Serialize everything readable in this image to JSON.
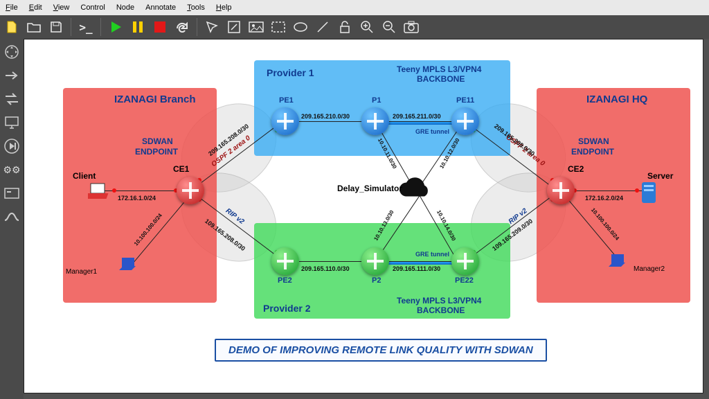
{
  "menu": {
    "file": "File",
    "edit": "Edit",
    "view": "View",
    "control": "Control",
    "node": "Node",
    "annotate": "Annotate",
    "tools": "Tools",
    "help": "Help"
  },
  "toolbar_icons": [
    "new-file-icon",
    "open-icon",
    "save-icon",
    "terminal-icon",
    "play-icon",
    "pause-icon",
    "stop-icon",
    "redo-icon",
    "select-icon",
    "edit-box-icon",
    "image-icon",
    "marquee-icon",
    "ellipse-icon",
    "line-icon",
    "lock-icon",
    "zoom-in-icon",
    "zoom-out-icon",
    "camera-icon"
  ],
  "sidebar_icons": [
    "move-icon",
    "arrow-right-icon",
    "arrow-bidir-icon",
    "monitor-icon",
    "step-icon",
    "gears-icon",
    "host-icon",
    "route-icon"
  ],
  "zones": {
    "branch": {
      "title": "IZANAGI Branch"
    },
    "hq": {
      "title": "IZANAGI HQ"
    },
    "p1": {
      "title": "Provider 1",
      "caption1": "Teeny MPLS L3/VPN4",
      "caption2": "BACKBONE"
    },
    "p2": {
      "title": "Provider 2",
      "caption1": "Teeny MPLS L3/VPN4",
      "caption2": "BACKBONE"
    }
  },
  "endpoint_label": {
    "l1": "SDWAN",
    "l2": "ENDPOINT"
  },
  "nodes": {
    "ce1": "CE1",
    "ce2": "CE2",
    "pe1": "PE1",
    "p1": "P1",
    "pe11": "PE11",
    "pe2": "PE2",
    "p2": "P2",
    "pe22": "PE22",
    "client": "Client",
    "server": "Server",
    "m1": "Manager1",
    "m2": "Manager2",
    "delay": "Delay_Simulator"
  },
  "subnets": {
    "client": "172.16.1.0/24",
    "server": "172.16.2.0/24",
    "ce1_pe1": "209.165.208.0/30",
    "ce1_pe2": "109.165.208.0/30",
    "pe1_p1": "209.165.210.0/30",
    "p1_pe11": "209.165.211.0/30",
    "pe2_p2": "209.165.110.0/30",
    "p2_pe22": "209.165.111.0/30",
    "pe11_ce2": "209.165.209.0/30",
    "pe22_ce2": "109.165.209.0/30",
    "m1": "10.100.100.0/24",
    "m2": "10.100.100.0/24",
    "ds_p1": "10.10.11.0/30",
    "ds_pe11": "10.10.12.0/30",
    "ds_p2": "10.10.13.0/30",
    "ds_pe22": "10.10.14.0/30"
  },
  "proto": {
    "ospf": "OSPF 2 area 0",
    "rip": "RIP v2"
  },
  "gre": "GRE tunnel",
  "banner": "DEMO OF IMPROVING REMOTE LINK QUALITY WITH SDWAN",
  "colors": {
    "red": "#ef5350",
    "blue": "#35aaf3",
    "green": "#43da5d",
    "navy": "#103a8f"
  }
}
